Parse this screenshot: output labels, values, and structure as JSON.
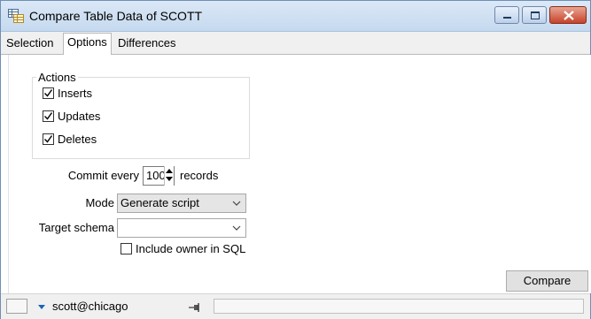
{
  "window": {
    "title": "Compare Table Data of SCOTT"
  },
  "tabs": [
    {
      "label": "Selection"
    },
    {
      "label": "Options"
    },
    {
      "label": "Differences"
    }
  ],
  "actions": {
    "group_label": "Actions",
    "items": [
      {
        "label": "Inserts",
        "checked": true
      },
      {
        "label": "Updates",
        "checked": true
      },
      {
        "label": "Deletes",
        "checked": true
      }
    ]
  },
  "commit": {
    "label": "Commit every",
    "value": "100",
    "suffix": "records"
  },
  "mode": {
    "label": "Mode",
    "value": "Generate script"
  },
  "target_schema": {
    "label": "Target schema",
    "value": ""
  },
  "include_owner": {
    "label": "Include owner in SQL",
    "checked": false
  },
  "compare_button": {
    "label": "Compare"
  },
  "statusbar": {
    "connection": "scott@chicago"
  }
}
